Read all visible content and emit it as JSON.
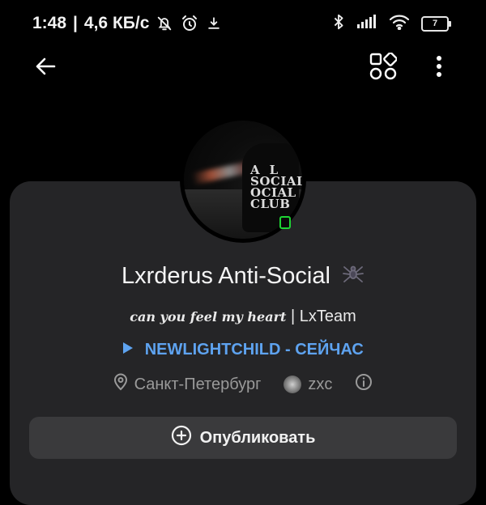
{
  "status_bar": {
    "time": "1:48",
    "separator": "|",
    "network_speed": "4,6 КБ/с",
    "battery_level": "7",
    "icons": [
      "bell-off-icon",
      "alarm-icon",
      "download-icon",
      "bluetooth-icon",
      "signal-icon",
      "wifi-icon",
      "battery-icon"
    ]
  },
  "app_bar": {
    "icons": [
      "back-arrow-icon",
      "apps-grid-icon",
      "more-vert-icon"
    ]
  },
  "profile": {
    "name": "Lxrderus Anti-Social",
    "name_emoji_icon": "spider-icon",
    "avatar_icon": "avatar-photo",
    "online_status": "online",
    "bio_styled": "can you feel my heart",
    "bio_rest": "| LxTeam",
    "music": "NEWLIGHTCHILD - СЕЙЧАС",
    "location": "Санкт-Петербург",
    "community": "zxc"
  },
  "actions": {
    "publish_label": "Опубликовать"
  },
  "colors": {
    "background": "#000000",
    "card": "#252527",
    "button": "#3a3a3c",
    "accent_link": "#5ea3f0",
    "online": "#1ed534",
    "muted_text": "#9a9a9a"
  }
}
